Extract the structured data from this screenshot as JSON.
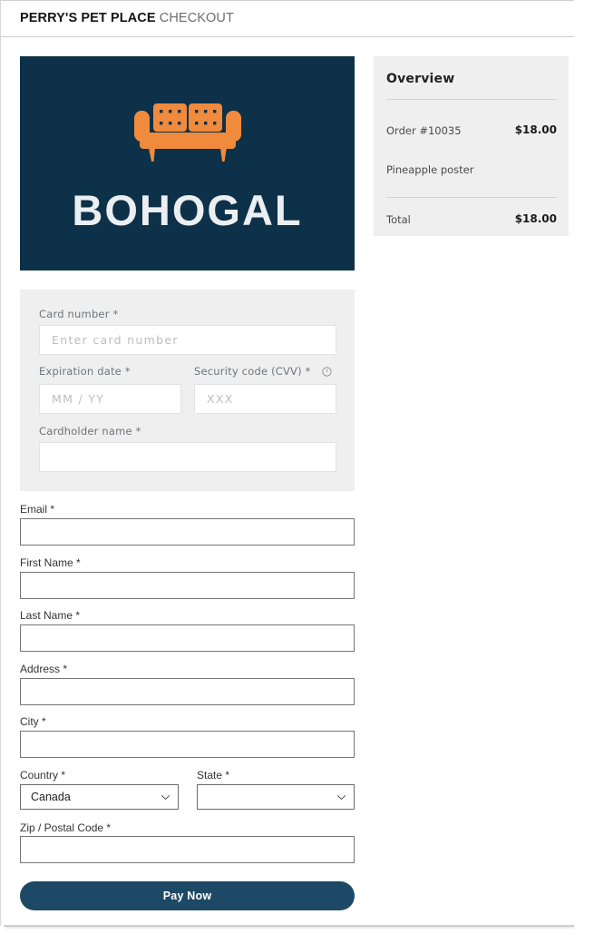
{
  "header": {
    "brand": "PERRY'S PET PLACE",
    "page_word": "CHECKOUT"
  },
  "banner": {
    "wordmark": "BOHOGAL",
    "icon": "couch-icon",
    "background_color": "#0d3149",
    "icon_color": "#f08a3c",
    "text_color": "#eceff1"
  },
  "overview": {
    "title": "Overview",
    "rows": [
      {
        "label": "Order #10035",
        "value": "$18.00"
      },
      {
        "label": "Pineapple poster",
        "value": ""
      }
    ],
    "total": {
      "label": "Total",
      "value": "$18.00"
    }
  },
  "payment": {
    "card_number": {
      "label": "Card number *",
      "value": "",
      "placeholder": "Enter card number"
    },
    "expiration": {
      "label": "Expiration date *",
      "value": "",
      "placeholder": "MM / YY"
    },
    "cvv": {
      "label": "Security code (CVV) *",
      "value": "",
      "placeholder": "XXX",
      "info_icon": "info-circle-icon"
    },
    "cardholder": {
      "label": "Cardholder name *",
      "value": "",
      "placeholder": ""
    }
  },
  "billing": {
    "email": {
      "label": "Email *",
      "value": ""
    },
    "first": {
      "label": "First Name *",
      "value": ""
    },
    "last": {
      "label": "Last Name *",
      "value": ""
    },
    "address": {
      "label": "Address *",
      "value": ""
    },
    "city": {
      "label": "City *",
      "value": ""
    },
    "country": {
      "label": "Country *",
      "value": "Canada"
    },
    "state": {
      "label": "State *",
      "value": ""
    },
    "zip": {
      "label": "Zip / Postal Code *",
      "value": ""
    }
  },
  "actions": {
    "pay": "Pay Now"
  },
  "colors": {
    "brand_navy": "#0d3149",
    "button_navy": "#1e4966",
    "accent_orange": "#f08a3c",
    "panel_gray": "#efefef"
  }
}
